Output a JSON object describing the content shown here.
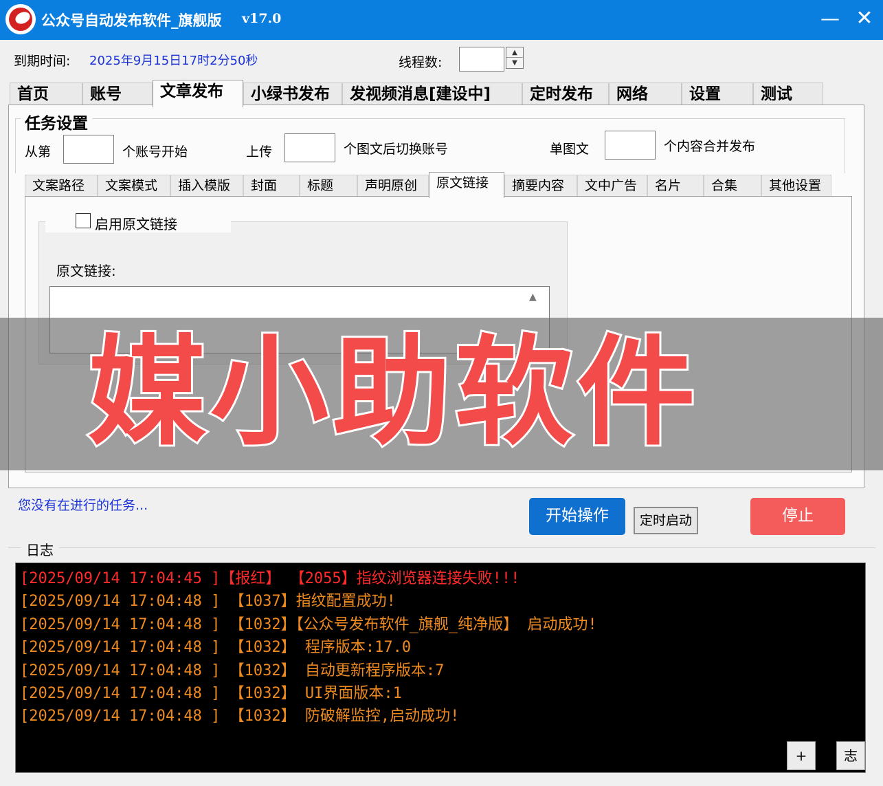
{
  "window": {
    "title": "公众号自动发布软件_旗舰版",
    "version": "v17.0",
    "minimize_glyph": "—",
    "close_glyph": "✕"
  },
  "header": {
    "expiry_label": "到期时间:",
    "expiry_value": "2025年9月15日17时2分50秒",
    "thread_label": "线程数:",
    "thread_value": ""
  },
  "main_tabs": [
    {
      "label": "首页",
      "active": false
    },
    {
      "label": "账号",
      "active": false
    },
    {
      "label": "文章发布",
      "active": true
    },
    {
      "label": "小绿书发布",
      "active": false
    },
    {
      "label": "发视频消息[建设中]",
      "active": false
    },
    {
      "label": "定时发布",
      "active": false
    },
    {
      "label": "网络",
      "active": false
    },
    {
      "label": "设置",
      "active": false
    },
    {
      "label": "测试",
      "active": false
    }
  ],
  "task_settings": {
    "title": "任务设置",
    "from_label": "从第",
    "from_suffix": "个账号开始",
    "upload_label": "上传",
    "upload_suffix": "个图文后切换账号",
    "single_label": "单图文",
    "single_suffix": "个内容合并发布",
    "from_value": "",
    "upload_value": "",
    "single_value": ""
  },
  "sub_tabs": [
    {
      "label": "文案路径",
      "active": false
    },
    {
      "label": "文案模式",
      "active": false
    },
    {
      "label": "插入模版",
      "active": false
    },
    {
      "label": "封面",
      "active": false
    },
    {
      "label": "标题",
      "active": false
    },
    {
      "label": "声明原创",
      "active": false
    },
    {
      "label": "原文链接",
      "active": true
    },
    {
      "label": "摘要内容",
      "active": false
    },
    {
      "label": "文中广告",
      "active": false
    },
    {
      "label": "名片",
      "active": false
    },
    {
      "label": "合集",
      "active": false
    },
    {
      "label": "其他设置",
      "active": false
    }
  ],
  "original_link": {
    "enable_label": "启用原文链接",
    "enabled": false,
    "link_label": "原文链接:",
    "link_value": ""
  },
  "watermark": "媒小助软件",
  "status": {
    "text": "您没有在进行的任务..."
  },
  "actions": {
    "start_label": "开始操作",
    "timer_label": "定时启动",
    "stop_label": "停止"
  },
  "log": {
    "title": "日志",
    "lines": [
      {
        "text": "[2025/09/14 17:04:45 ]【报红】 【2055】指纹浏览器连接失败!!!",
        "level": "error"
      },
      {
        "text": "[2025/09/14 17:04:48 ] 【1037】指纹配置成功!",
        "level": "info"
      },
      {
        "text": "[2025/09/14 17:04:48 ] 【1032】【公众号发布软件_旗舰_纯净版】 启动成功!",
        "level": "info"
      },
      {
        "text": "[2025/09/14 17:04:48 ] 【1032】 程序版本:17.0",
        "level": "info"
      },
      {
        "text": "[2025/09/14 17:04:48 ] 【1032】 自动更新程序版本:7",
        "level": "info"
      },
      {
        "text": "[2025/09/14 17:04:48 ] 【1032】 UI界面版本:1",
        "level": "info"
      },
      {
        "text": "[2025/09/14 17:04:48 ] 【1032】 防破解监控,启动成功!",
        "level": "info"
      }
    ],
    "plus_label": "+",
    "zhi_label": "志"
  },
  "colors": {
    "titlebar": "#0a7fe0",
    "link_blue": "#1c34d6",
    "start_button": "#0f70cf",
    "stop_button": "#f45b5b",
    "log_error": "#ff2b2b",
    "log_info": "#ee8a1f",
    "watermark": "#f34a4a"
  },
  "icons": {
    "logo": "app-logo-icon",
    "spinner_up": "spinner-up-icon",
    "spinner_down": "spinner-down-icon",
    "scroll_up": "scroll-up-arrow-icon"
  }
}
